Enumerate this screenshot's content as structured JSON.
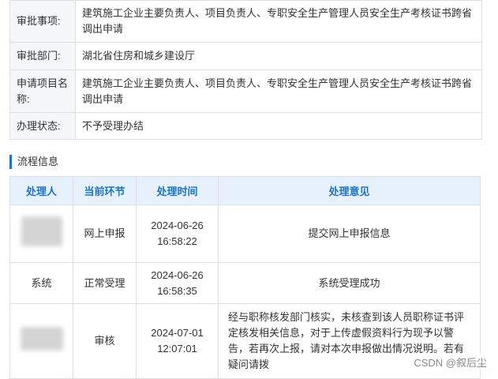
{
  "info": {
    "rows": [
      {
        "label": "审批事项:",
        "value": "建筑施工企业主要负责人、项目负责人、专职安全生产管理人员安全生产考核证书跨省调出申请"
      },
      {
        "label": "审批部门:",
        "value": "湖北省住房和城乡建设厅"
      },
      {
        "label": "申请项目名称:",
        "value": "建筑施工企业主要负责人、项目负责人、专职安全生产管理人员安全生产考核证书跨省调出申请"
      },
      {
        "label": "办理状态:",
        "value": "不予受理办结"
      }
    ]
  },
  "flow": {
    "section_title": "流程信息",
    "headers": [
      "处理人",
      "当前环节",
      "处理时间",
      "处理意见"
    ],
    "rows": [
      {
        "handler": "",
        "step": "网上申报",
        "date": "2024-06-26",
        "time": "16:58:22",
        "opinion": "提交网上申报信息"
      },
      {
        "handler": "系统",
        "step": "正常受理",
        "date": "2024-06-26",
        "time": "16:58:35",
        "opinion": "系统受理成功"
      },
      {
        "handler": "",
        "step": "审核",
        "date": "2024-07-01",
        "time": "12:07:01",
        "opinion": "经与职称核发部门核实，未核查到该人员职称证书评定核发相关信息，对于上传虚假资料行为现予以警告，若再次上报，请对本次申报做出情况说明。若有疑问请拨"
      }
    ]
  },
  "watermark": "CSDN @叙后尘",
  "colors": {
    "accent": "#1a73c8",
    "header_bg": "#e7f1fb",
    "label_bg": "#f5f6f8",
    "border": "#dcdfe6"
  }
}
